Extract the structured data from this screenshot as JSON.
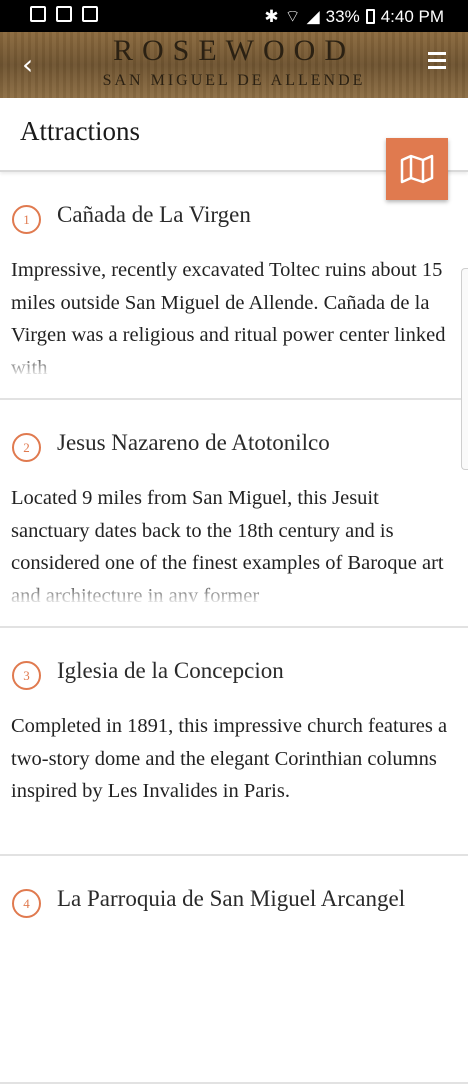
{
  "status": {
    "battery": "33%",
    "time": "4:40 PM"
  },
  "header": {
    "brand_line1": "ROSEWOOD",
    "brand_line2": "SAN MIGUEL DE ALLENDE"
  },
  "page": {
    "title": "Attractions"
  },
  "attractions": [
    {
      "num": "1",
      "title": "Cañada de La Virgen",
      "desc": "Impressive, recently excavated Toltec ruins about 15 miles outside San Miguel de Allende. Cañada de la Virgen was a religious and ritual power center linked with"
    },
    {
      "num": "2",
      "title": "Jesus Nazareno de Atotonilco",
      "desc": "Located 9 miles from San Miguel, this Jesuit sanctuary dates back to the 18th century and is considered one of the finest examples of Baroque art and architecture in any former"
    },
    {
      "num": "3",
      "title": "Iglesia de la Concepcion",
      "desc": "Completed in 1891, this impressive church features a two-story dome and the elegant Corinthian columns inspired by Les Invalides in Paris."
    },
    {
      "num": "4",
      "title": "La Parroquia de San Miguel Arcangel",
      "desc": ""
    }
  ]
}
